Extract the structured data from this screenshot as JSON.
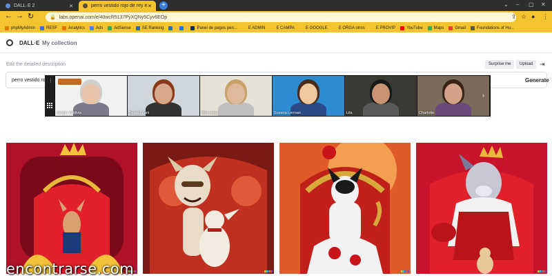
{
  "browser": {
    "tabs": [
      {
        "label": "DALL·E 2",
        "active": false
      },
      {
        "label": "perro vestido rojo de rey en el tr",
        "active": true
      }
    ],
    "url": "labs.openai.com/e/40wcR5137PyXQNy5Cyv6EOp",
    "bookmarks": [
      {
        "label": "phpMyAdmin",
        "color": "#e27a00"
      },
      {
        "label": "RESF",
        "color": "#3a6fd8"
      },
      {
        "label": "Analytics",
        "color": "#e37400"
      },
      {
        "label": "Ads",
        "color": "#4285f4"
      },
      {
        "label": "AdSense",
        "color": "#34a853"
      },
      {
        "label": "SE Ranking",
        "color": "#2b6cb0"
      },
      {
        "label": "",
        "color": "#2a6ebb"
      },
      {
        "label": "",
        "color": "#1a73e8"
      },
      {
        "label": "Panel de pagos peri...",
        "color": "#0a2a66"
      },
      {
        "label": "E ADMIN",
        "color": "#f4c430"
      },
      {
        "label": "E CAMPA",
        "color": "#f4c430"
      },
      {
        "label": "E GOOGLE",
        "color": "#f4c430"
      },
      {
        "label": "E ORGA otros",
        "color": "#f4c430"
      },
      {
        "label": "E PROVIP",
        "color": "#f4c430"
      },
      {
        "label": "YouTube",
        "color": "#ff0000"
      },
      {
        "label": "Maps",
        "color": "#34a853"
      },
      {
        "label": "Gmail",
        "color": "#ea4335"
      },
      {
        "label": "Foundations of Hu...",
        "color": "#555555"
      }
    ]
  },
  "app": {
    "brand": "DALL·E",
    "collection_link": "My collection",
    "description_label": "Edit the detailed description",
    "surprise_label": "Surprise me",
    "upload_label": "Upload",
    "prompt_value": "perro vestido ro",
    "generate_label": "Generate"
  },
  "video_call": {
    "participants": [
      {
        "name": "Sergio Valdivia",
        "bg": "#f2f2f2"
      },
      {
        "name": "Beatriz Zani",
        "bg": "#cfd6dc"
      },
      {
        "name": "Mercedes",
        "bg": "#e6e2d8"
      },
      {
        "name": "Susana Lerman",
        "bg": "#2d8bd0"
      },
      {
        "name": "Lila",
        "bg": "#3a3a35"
      },
      {
        "name": "Charlotte",
        "bg": "#7a6a5a"
      }
    ]
  },
  "results": [
    {
      "name": "result-image-1",
      "bg": "#b0122a"
    },
    {
      "name": "result-image-2",
      "bg": "#7a1a14"
    },
    {
      "name": "result-image-3",
      "bg": "#e05a2a"
    },
    {
      "name": "result-image-4",
      "bg": "#c8142a"
    }
  ],
  "watermark": "encontrarse.com"
}
